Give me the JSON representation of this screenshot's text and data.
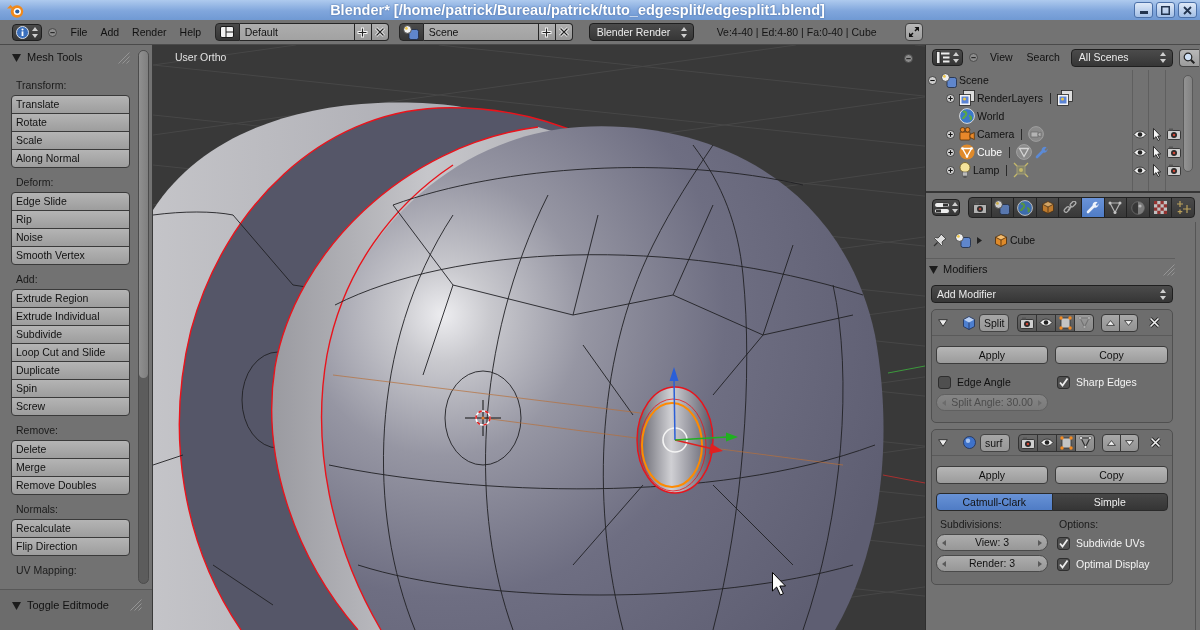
{
  "window": {
    "title": "Blender* [/home/patrick/Bureau/patrick/tuto_edgesplit/edgesplit1.blend]"
  },
  "header": {
    "menus": [
      "File",
      "Add",
      "Render",
      "Help"
    ],
    "screen_layout": "Default",
    "scene": "Scene",
    "render_engine": "Blender Render",
    "stats": "Ve:4-40 | Ed:4-80 | Fa:0-40 | Cube"
  },
  "tool_shelf": {
    "title": "Mesh Tools",
    "expanded": true,
    "sections": [
      {
        "label": "Transform:",
        "buttons": [
          "Translate",
          "Rotate",
          "Scale",
          "Along Normal"
        ]
      },
      {
        "label": "Deform:",
        "buttons": [
          "Edge Slide",
          "Rip",
          "Noise",
          "Smooth Vertex"
        ]
      },
      {
        "label": "Add:",
        "buttons": [
          "Extrude Region",
          "Extrude Individual",
          "Subdivide",
          "Loop Cut and Slide",
          "Duplicate",
          "Spin",
          "Screw"
        ]
      },
      {
        "label": "Remove:",
        "buttons": [
          "Delete",
          "Merge",
          "Remove Doubles"
        ]
      },
      {
        "label": "Normals:",
        "buttons": [
          "Recalculate",
          "Flip Direction"
        ]
      },
      {
        "label": "UV Mapping:"
      }
    ],
    "operator_panel": {
      "title": "Toggle Editmode",
      "expanded": true
    }
  },
  "viewport": {
    "view_label": "User Ortho"
  },
  "outliner": {
    "menus": [
      "View",
      "Search"
    ],
    "filter": "All Scenes",
    "items": [
      {
        "label": "Scene",
        "kind": "scene",
        "expanded": true,
        "selected": false,
        "children": [
          {
            "label": "RenderLayers",
            "kind": "render_layers",
            "expanded": false,
            "selected": false
          },
          {
            "label": "World",
            "kind": "world",
            "selected": false
          },
          {
            "label": "Camera",
            "kind": "camera",
            "expanded": false,
            "selected": false
          },
          {
            "label": "Cube",
            "kind": "mesh",
            "expanded": false,
            "selected": true
          },
          {
            "label": "Lamp",
            "kind": "lamp",
            "expanded": false,
            "selected": false
          }
        ]
      }
    ]
  },
  "properties": {
    "tabs": [
      {
        "kind": "render",
        "selected": false
      },
      {
        "kind": "scene",
        "selected": false
      },
      {
        "kind": "world",
        "selected": false
      },
      {
        "kind": "object",
        "selected": false
      },
      {
        "kind": "constraints",
        "selected": false
      },
      {
        "kind": "modifiers",
        "selected": true
      },
      {
        "kind": "data",
        "selected": false
      },
      {
        "kind": "material",
        "selected": false
      },
      {
        "kind": "texture",
        "selected": false
      },
      {
        "kind": "particles",
        "selected": false
      }
    ],
    "context_path": "Cube",
    "panel": {
      "title": "Modifiers",
      "expanded": true
    },
    "add_modifier": "Add Modifier",
    "modifiers": [
      {
        "kind": "edge_split",
        "name": "Split",
        "expanded": true,
        "toggles": [
          {
            "kind": "render",
            "on": true,
            "disabled": false
          },
          {
            "kind": "viewport",
            "on": true,
            "disabled": false
          },
          {
            "kind": "editmode",
            "on": true,
            "disabled": false
          },
          {
            "kind": "cage",
            "on": false,
            "disabled": true
          }
        ],
        "actions": [
          "Apply",
          "Copy"
        ],
        "controls": [
          {
            "kind": "checkbox",
            "label": "Edge Angle",
            "checked": false
          },
          {
            "kind": "checkbox",
            "label": "Sharp Edges",
            "checked": true
          },
          {
            "kind": "number",
            "label": "Split Angle: 30.00",
            "disabled": true
          }
        ]
      },
      {
        "kind": "subsurf",
        "name": "surf",
        "expanded": true,
        "toggles": [
          {
            "kind": "render",
            "on": true,
            "disabled": false
          },
          {
            "kind": "viewport",
            "on": true,
            "disabled": false
          },
          {
            "kind": "editmode",
            "on": true,
            "disabled": false
          },
          {
            "kind": "cage",
            "on": false,
            "disabled": false
          }
        ],
        "actions": [
          "Apply",
          "Copy"
        ],
        "controls": [
          {
            "kind": "segmented",
            "options": [
              {
                "label": "Catmull-Clark",
                "selected": true
              },
              {
                "label": "Simple",
                "selected": false
              }
            ]
          },
          {
            "kind": "heading",
            "label": "Subdivisions:"
          },
          {
            "kind": "heading",
            "label": "Options:"
          },
          {
            "kind": "number",
            "label": "View: 3",
            "disabled": false
          },
          {
            "kind": "checkbox",
            "label": "Subdivide UVs",
            "checked": true
          },
          {
            "kind": "number",
            "label": "Render: 3",
            "disabled": false
          },
          {
            "kind": "checkbox",
            "label": "Optimal Display",
            "checked": true
          }
        ]
      }
    ]
  }
}
